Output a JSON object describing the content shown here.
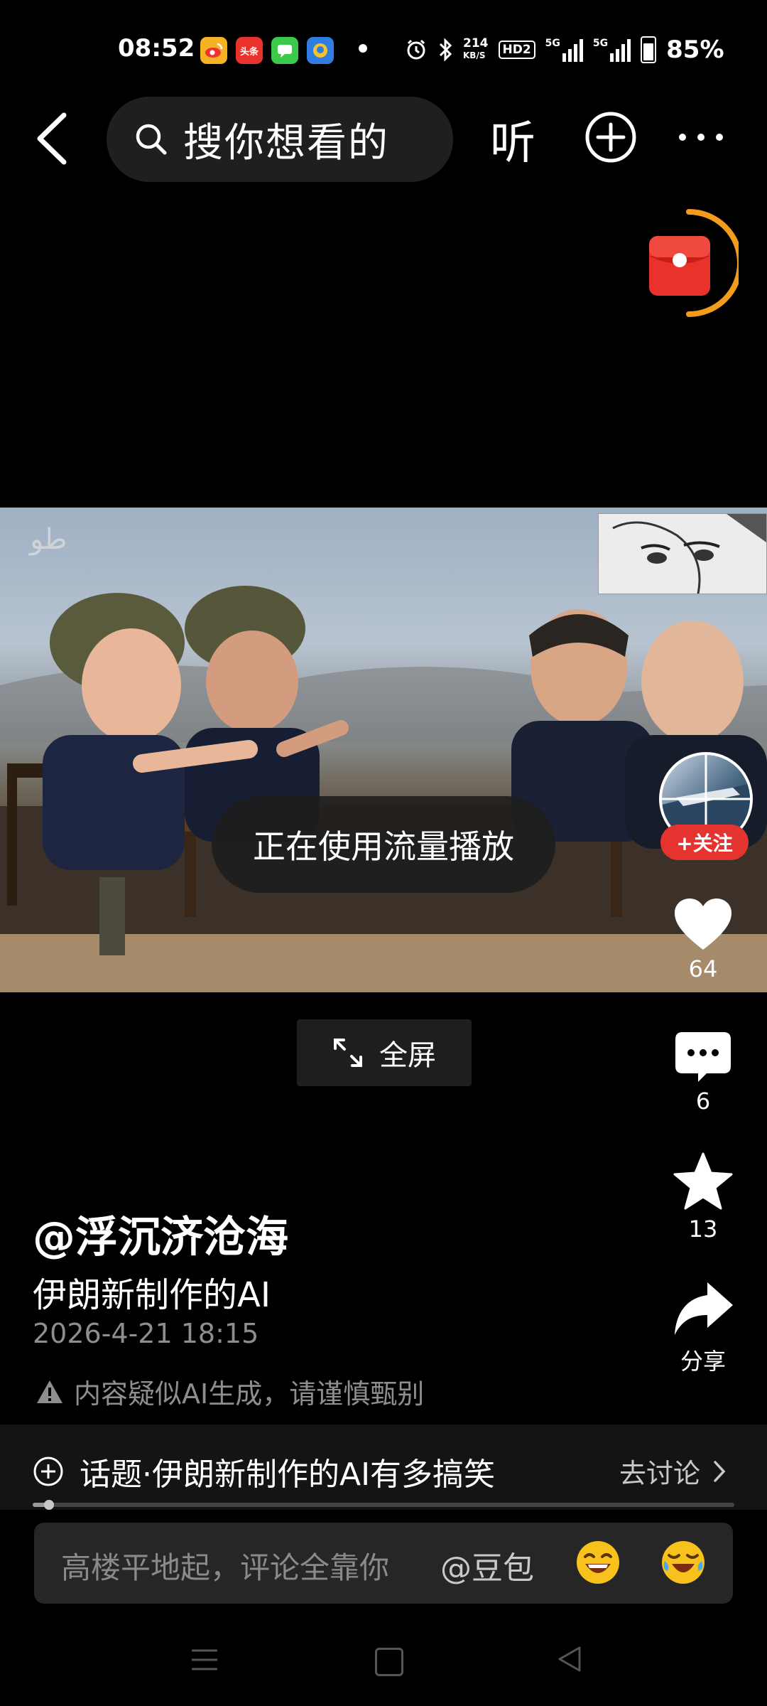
{
  "status_bar": {
    "time": "08:52",
    "app_icons": [
      {
        "name": "weibo-icon",
        "text": "",
        "color": "#f5b324"
      },
      {
        "name": "toutiao-icon",
        "text": "头条",
        "color": "#e8322b"
      },
      {
        "name": "messages-icon",
        "text": "",
        "color": "#3cc84a"
      },
      {
        "name": "app-badge-icon",
        "text": "",
        "color": "#2f7de1"
      }
    ],
    "net_speed_value": "214",
    "net_speed_unit": "KB/S",
    "hd_label": "HD2",
    "signal1_label": "5G",
    "signal2_label": "5G",
    "battery": "85%"
  },
  "top_nav": {
    "search_placeholder": "搜你想看的",
    "listen_label": "听"
  },
  "video": {
    "network_notice": "正在使用流量播放",
    "fullscreen_label": "全屏"
  },
  "actions": {
    "follow_label": "+关注",
    "likes": "64",
    "comments": "6",
    "favorites": "13",
    "share_label": "分享"
  },
  "post": {
    "author": "@浮沉济沧海",
    "title": "伊朗新制作的AI",
    "date": "2026-4-21 18:15",
    "ai_notice": "内容疑似AI生成，请谨慎甄别"
  },
  "topic": {
    "label": "话题·伊朗新制作的AI有多搞笑",
    "action": "去讨论"
  },
  "progress": {
    "fraction": 0.02
  },
  "comment": {
    "placeholder": "高楼平地起，评论全靠你",
    "mention": "@豆包"
  },
  "colors": {
    "accent_red": "#e5332f",
    "countdown_orange": "#f39b1c",
    "muted_text": "#8e8e8e"
  }
}
